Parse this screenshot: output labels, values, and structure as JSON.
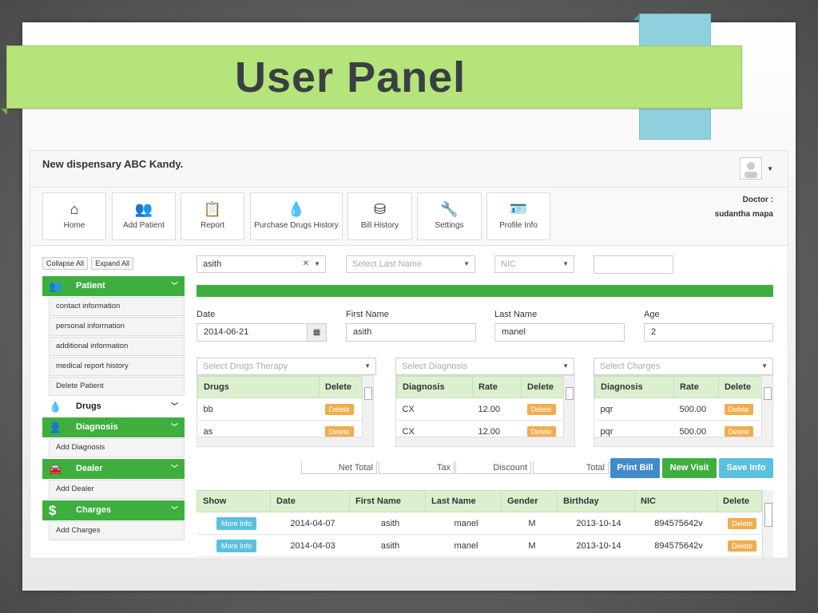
{
  "slide": {
    "title": "User Panel"
  },
  "app": {
    "brand": "New dispensary ABC Kandy.",
    "doctor_label": "Doctor :",
    "doctor_name": "sudantha mapa"
  },
  "toolbar": [
    {
      "label": "Home",
      "icon": "home-icon"
    },
    {
      "label": "Add Patient",
      "icon": "users-icon"
    },
    {
      "label": "Report",
      "icon": "clipboard-icon"
    },
    {
      "label": "Purchase Drugs History",
      "icon": "drops-icon"
    },
    {
      "label": "Bill History",
      "icon": "coins-icon"
    },
    {
      "label": "Settings",
      "icon": "wrench-icon"
    },
    {
      "label": "Profile Info",
      "icon": "contact-icon"
    }
  ],
  "sidebar": {
    "collapse_all": "Collapse All",
    "expand_all": "Expand All",
    "patient": {
      "label": "Patient",
      "items": [
        "contact information",
        "personal information",
        "additional information",
        "medical report history",
        "Delete Patient"
      ]
    },
    "drugs": {
      "label": "Drugs"
    },
    "diagnosis": {
      "label": "Diagnosis",
      "items": [
        "Add Diagnosis"
      ]
    },
    "dealer": {
      "label": "Dealer",
      "items": [
        "Add Dealer"
      ]
    },
    "charges": {
      "label": "Charges",
      "items": [
        "Add Charges"
      ]
    }
  },
  "search": {
    "first_name_value": "asith",
    "last_name_placeholder": "Select Last Name",
    "nic_placeholder": "NIC",
    "extra_value": ""
  },
  "form": {
    "date_label": "Date",
    "date_value": "2014-06-21",
    "first_name_label": "First Name",
    "first_name_value": "asith",
    "last_name_label": "Last Name",
    "last_name_value": "manel",
    "age_label": "Age",
    "age_value": "2"
  },
  "drugs_table": {
    "placeholder": "Select Drugs Therapy",
    "headers": [
      "Drugs",
      "Delete"
    ],
    "rows": [
      [
        "bb",
        "Delete"
      ],
      [
        "as",
        "Delete"
      ]
    ]
  },
  "diagnosis_table": {
    "placeholder": "Select Diagnosis",
    "headers": [
      "Diagnosis",
      "Rate",
      "Delete"
    ],
    "rows": [
      [
        "CX",
        "12.00",
        "Delete"
      ],
      [
        "CX",
        "12.00",
        "Delete"
      ]
    ]
  },
  "charges_table": {
    "placeholder": "Select Charges",
    "headers": [
      "Diagnosis",
      "Rate",
      "Delete"
    ],
    "rows": [
      [
        "pqr",
        "500.00",
        "Delete"
      ],
      [
        "pqr",
        "500.00",
        "Delete"
      ]
    ]
  },
  "totals": {
    "net_total": "Net Total",
    "tax": "Tax",
    "discount": "Discount",
    "total": "Total",
    "print_bill": "Print Bill",
    "new_visit": "New Visit",
    "save_info": "Save Info"
  },
  "history_table": {
    "headers": [
      "Show",
      "Date",
      "First Name",
      "Last Name",
      "Gender",
      "Birthday",
      "NIC",
      "Delete"
    ],
    "rows": [
      [
        "More Info",
        "2014-04-07",
        "asith",
        "manel",
        "M",
        "2013-10-14",
        "894575642v",
        "Delete"
      ],
      [
        "More Info",
        "2014-04-03",
        "asith",
        "manel",
        "M",
        "2013-10-14",
        "894575642v",
        "Delete"
      ]
    ]
  },
  "colors": {
    "green": "#3eaf3f",
    "banner": "#b5e47a",
    "blue_tab": "#8fd0df",
    "orange": "#f0ad4e",
    "info": "#5bc0de",
    "primary": "#428bca"
  }
}
